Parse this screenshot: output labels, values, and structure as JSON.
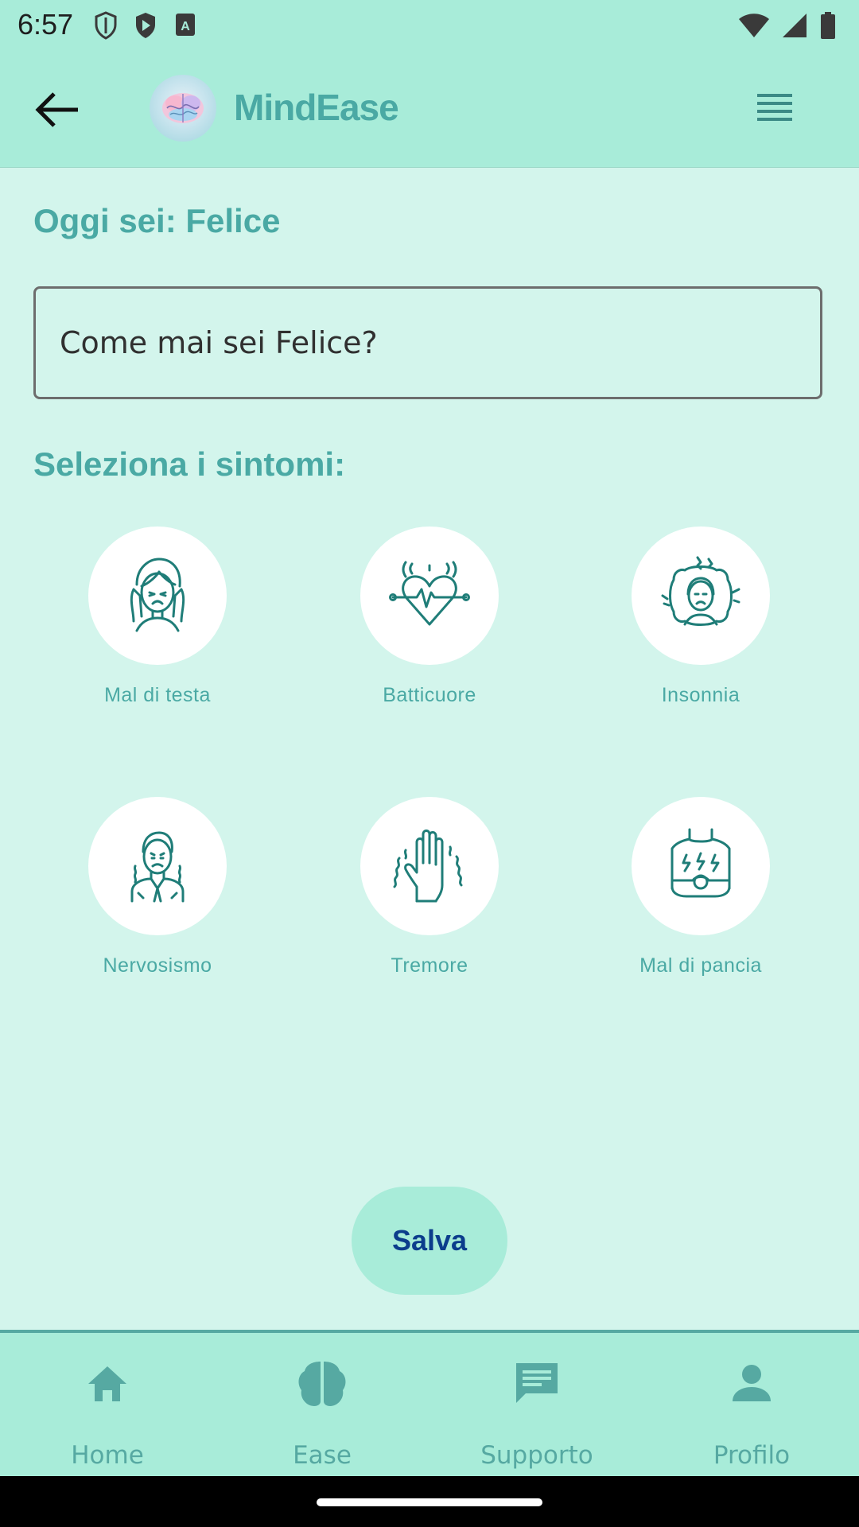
{
  "status_bar": {
    "time": "6:57"
  },
  "app_bar": {
    "title": "MindEase"
  },
  "mood": {
    "heading": "Oggi sei: Felice",
    "input_placeholder": "Come mai sei Felice?"
  },
  "symptoms": {
    "heading": "Seleziona i sintomi:",
    "items": [
      {
        "label": "Mal di testa",
        "icon": "headache-icon"
      },
      {
        "label": "Batticuore",
        "icon": "heartbeat-icon"
      },
      {
        "label": "Insonnia",
        "icon": "insomnia-icon"
      },
      {
        "label": "Nervosismo",
        "icon": "nervousness-icon"
      },
      {
        "label": "Tremore",
        "icon": "tremor-hand-icon"
      },
      {
        "label": "Mal di pancia",
        "icon": "stomachache-icon"
      }
    ]
  },
  "save_label": "Salva",
  "bottom_nav": {
    "items": [
      {
        "label": "Home",
        "icon": "home-icon"
      },
      {
        "label": "Ease",
        "icon": "brain-icon"
      },
      {
        "label": "Supporto",
        "icon": "chat-icon"
      },
      {
        "label": "Profilo",
        "icon": "person-icon"
      }
    ]
  },
  "colors": {
    "accent": "#4aa9a4",
    "bar_background": "#a8ecd9",
    "page_background": "#d3f5ec",
    "icon_stroke": "#1f7d78",
    "save_text": "#0b3d8c"
  }
}
